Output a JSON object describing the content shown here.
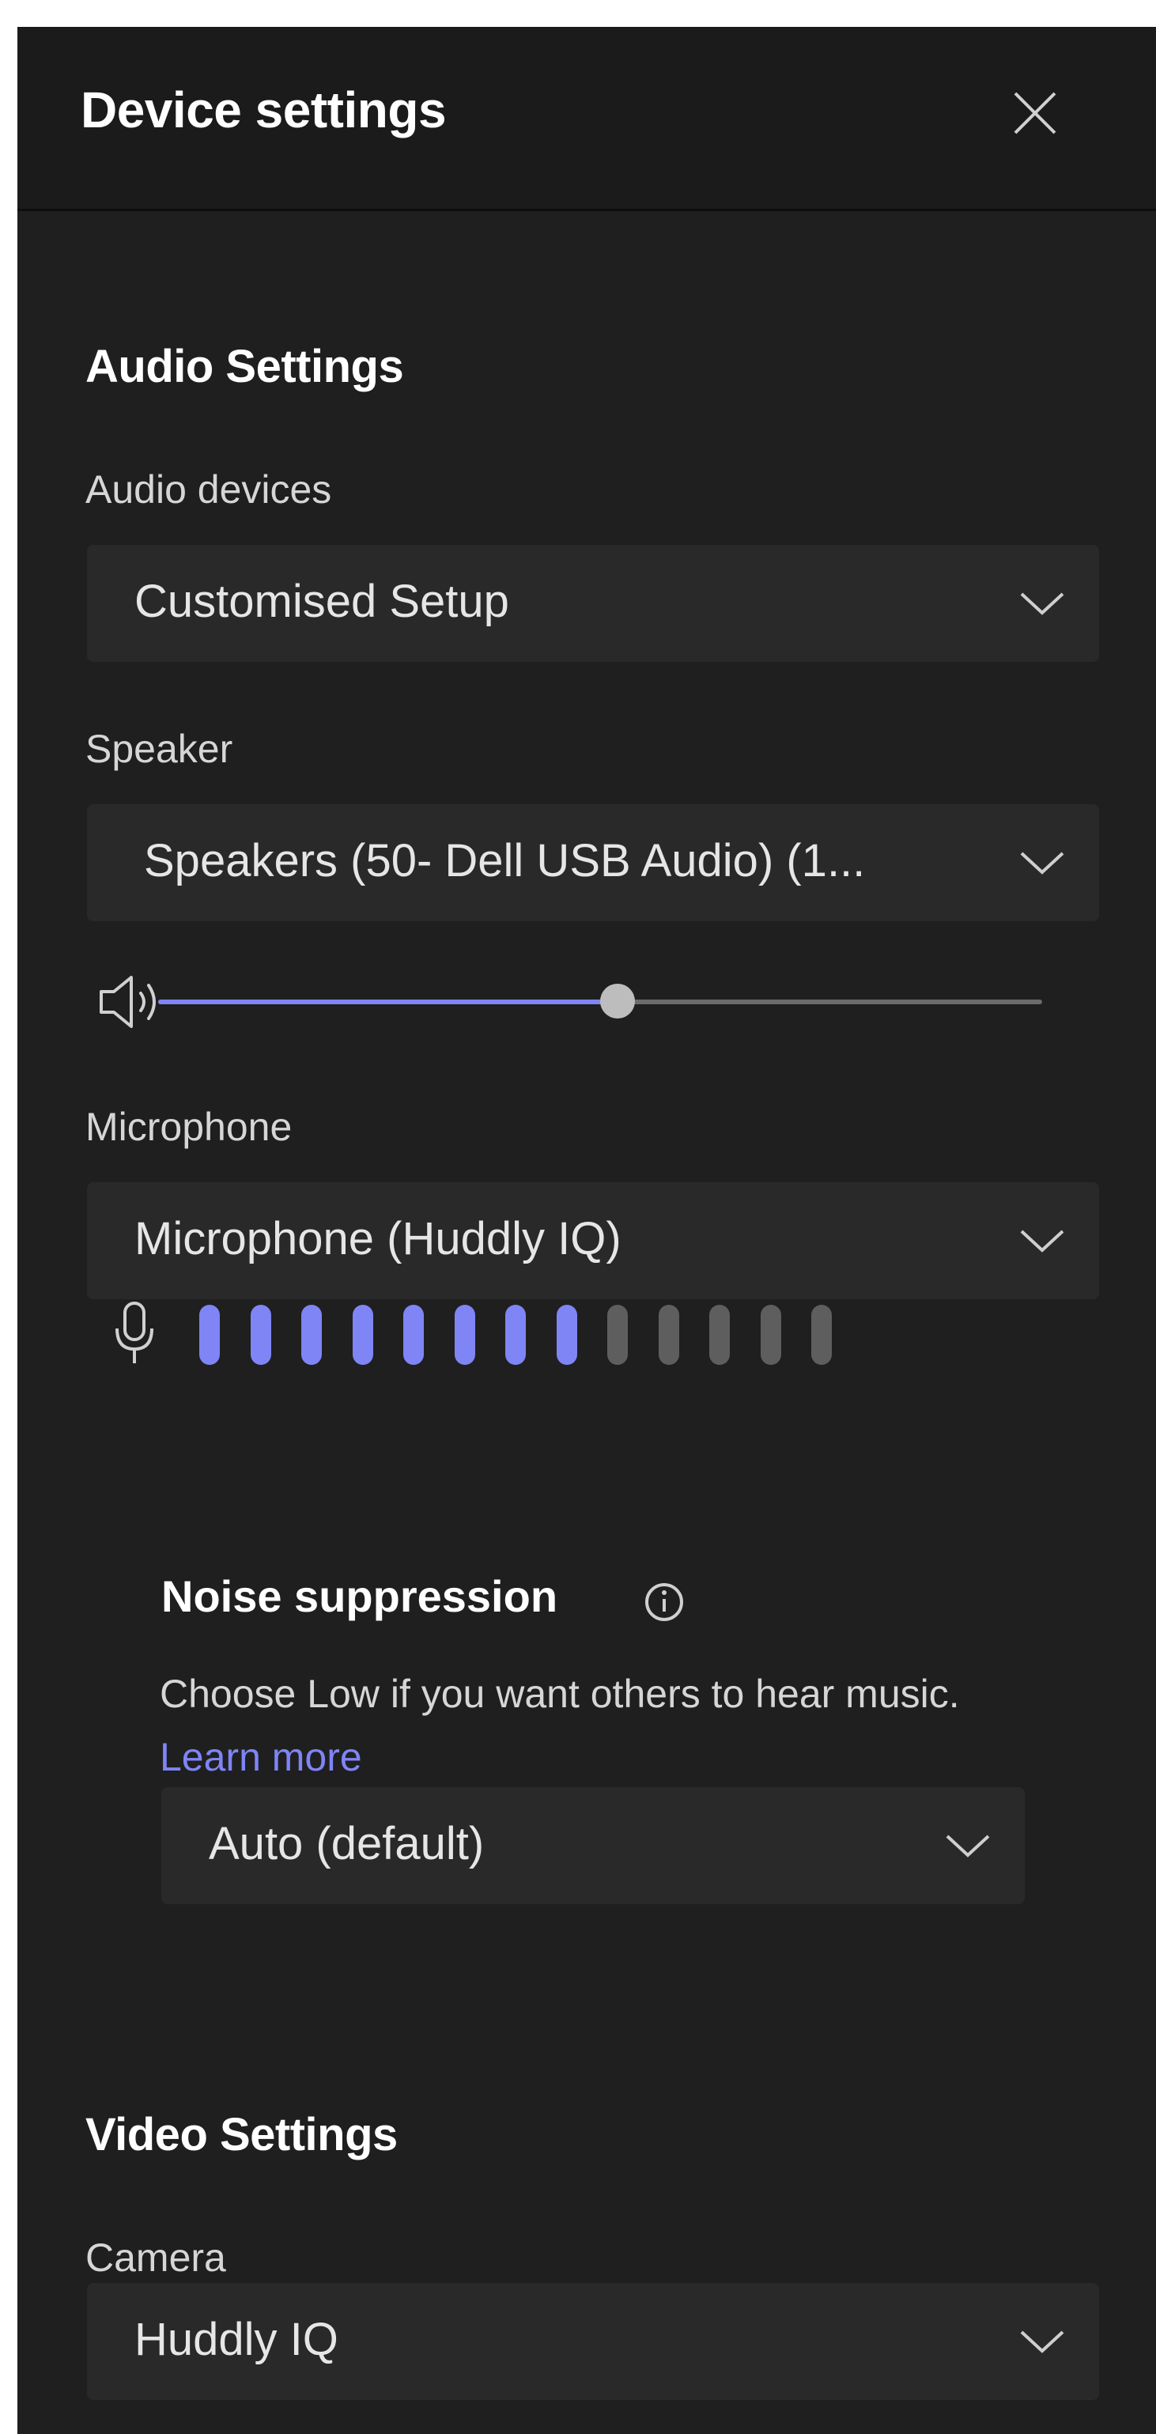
{
  "header": {
    "title": "Device settings"
  },
  "audio": {
    "section_title": "Audio Settings",
    "devices": {
      "label": "Audio devices",
      "value": "Customised Setup"
    },
    "speaker": {
      "label": "Speaker",
      "value": "Speakers (50- Dell USB Audio) (1...",
      "volume": 0.52
    },
    "microphone": {
      "label": "Microphone",
      "value": "Microphone (Huddly IQ)",
      "level_active": 8,
      "level_total": 13
    },
    "noise_suppression": {
      "title": "Noise suppression",
      "description": "Choose Low if you want others to hear music.",
      "link": "Learn more",
      "value": "Auto (default)"
    }
  },
  "video": {
    "section_title": "Video Settings",
    "camera": {
      "label": "Camera",
      "value": "Huddly IQ"
    }
  },
  "colors": {
    "accent": "#7f85f5",
    "inactive": "#5e5e5e",
    "panel": "#1f1f1f",
    "field": "#292929"
  },
  "icons": {
    "close": "close-icon",
    "chevron": "chevron-down-icon",
    "speaker": "speaker-icon",
    "microphone": "microphone-icon",
    "info": "info-icon"
  }
}
